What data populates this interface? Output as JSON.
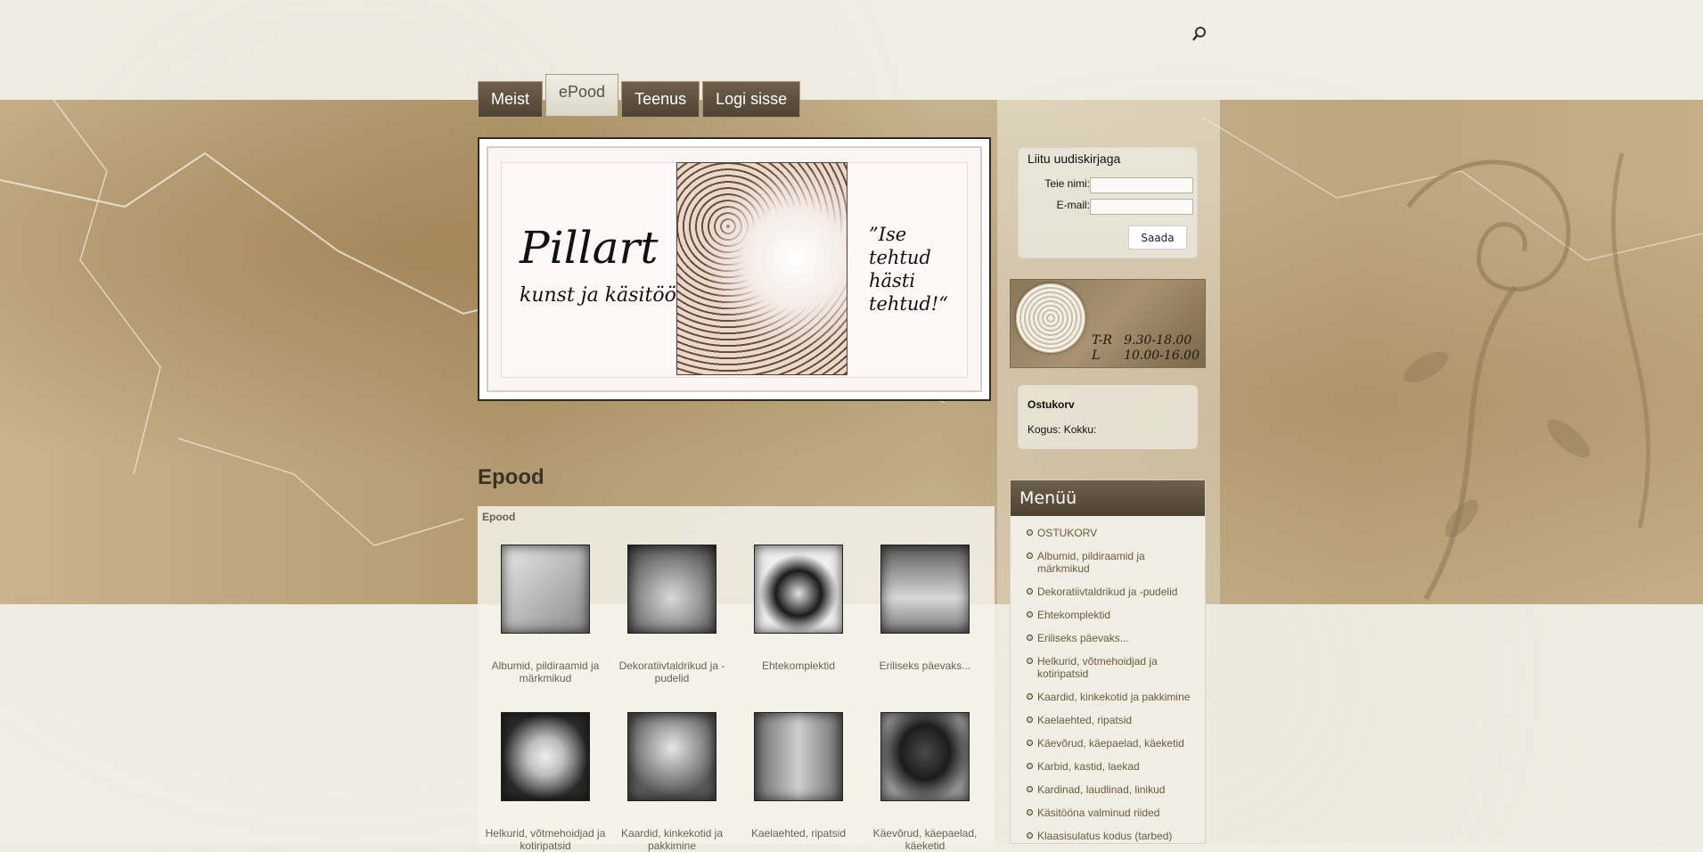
{
  "nav": {
    "tabs": [
      {
        "label": "Meist"
      },
      {
        "label": "ePood"
      },
      {
        "label": "Teenus"
      },
      {
        "label": "Logi sisse"
      }
    ]
  },
  "banner": {
    "title": "Pillart",
    "subtitle": "kunst ja käsitöö",
    "quote": "”Ise tehtud hästi tehtud!“"
  },
  "newsletter": {
    "title": "Liitu uudiskirjaga",
    "name_label": "Teie nimi:",
    "email_label": "E-mail:",
    "name_value": "",
    "email_value": "",
    "submit_label": "Saada"
  },
  "hours": {
    "text": "T-R   9.30-18.00\nL      10.00-16.00"
  },
  "cart": {
    "title": "Ostukorv",
    "summary": "Kogus:  Kokku:"
  },
  "main": {
    "page_title": "Epood",
    "section_label": "Epood",
    "products": [
      {
        "name": "Albumid, pildiraamid ja märkmikud"
      },
      {
        "name": "Dekoratiivtaldrikud ja -pudelid"
      },
      {
        "name": "Ehtekomplektid"
      },
      {
        "name": "Eriliseks päevaks..."
      },
      {
        "name": "Helkurid, võtmehoidjad ja kotiripatsid"
      },
      {
        "name": "Kaardid, kinkekotid ja pakkimine"
      },
      {
        "name": "Kaelaehted, ripatsid"
      },
      {
        "name": "Käevõrud, käepaelad, käeketid"
      }
    ]
  },
  "menu": {
    "title": "Menüü",
    "items": [
      {
        "label": "OSTUKORV"
      },
      {
        "label": "Albumid, pildiraamid ja märkmikud"
      },
      {
        "label": "Dekoratiivtaldrikud ja -pudelid"
      },
      {
        "label": "Ehtekomplektid"
      },
      {
        "label": "Eriliseks päevaks..."
      },
      {
        "label": "Helkurid, võtmehoidjad ja kotiripatsid"
      },
      {
        "label": "Kaardid, kinkekotid ja pakkimine"
      },
      {
        "label": "Kaelaehted, ripatsid"
      },
      {
        "label": "Käevõrud, käepaelad, käeketid"
      },
      {
        "label": "Karbid, kastid, laekad"
      },
      {
        "label": "Kardinad, laudlinad, linikud"
      },
      {
        "label": "Käsitööna valminud riided"
      },
      {
        "label": "Klaasisulatus kodus (tarbed)"
      }
    ]
  }
}
